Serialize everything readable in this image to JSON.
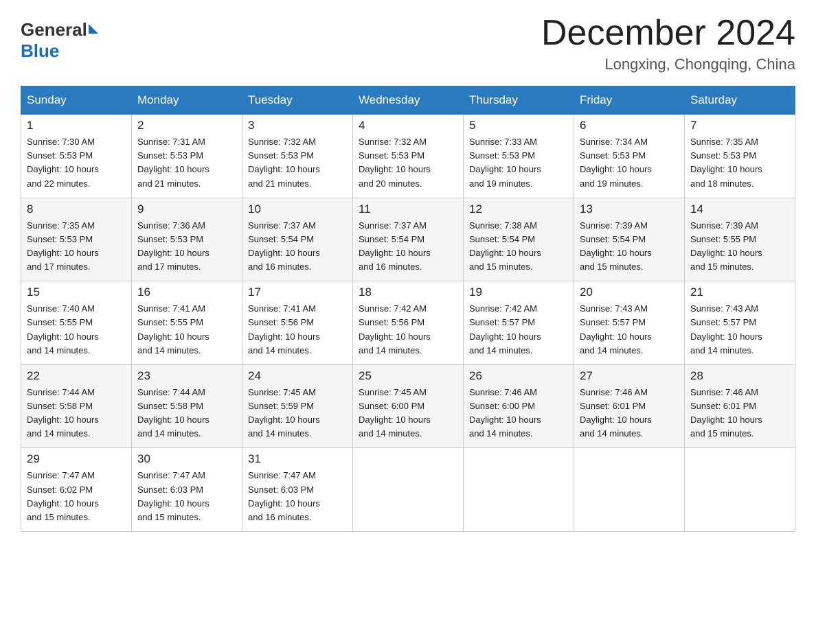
{
  "logo": {
    "general": "General",
    "blue": "Blue"
  },
  "header": {
    "month": "December 2024",
    "location": "Longxing, Chongqing, China"
  },
  "days_of_week": [
    "Sunday",
    "Monday",
    "Tuesday",
    "Wednesday",
    "Thursday",
    "Friday",
    "Saturday"
  ],
  "weeks": [
    [
      {
        "day": "1",
        "sunrise": "7:30 AM",
        "sunset": "5:53 PM",
        "daylight": "10 hours and 22 minutes."
      },
      {
        "day": "2",
        "sunrise": "7:31 AM",
        "sunset": "5:53 PM",
        "daylight": "10 hours and 21 minutes."
      },
      {
        "day": "3",
        "sunrise": "7:32 AM",
        "sunset": "5:53 PM",
        "daylight": "10 hours and 21 minutes."
      },
      {
        "day": "4",
        "sunrise": "7:32 AM",
        "sunset": "5:53 PM",
        "daylight": "10 hours and 20 minutes."
      },
      {
        "day": "5",
        "sunrise": "7:33 AM",
        "sunset": "5:53 PM",
        "daylight": "10 hours and 19 minutes."
      },
      {
        "day": "6",
        "sunrise": "7:34 AM",
        "sunset": "5:53 PM",
        "daylight": "10 hours and 19 minutes."
      },
      {
        "day": "7",
        "sunrise": "7:35 AM",
        "sunset": "5:53 PM",
        "daylight": "10 hours and 18 minutes."
      }
    ],
    [
      {
        "day": "8",
        "sunrise": "7:35 AM",
        "sunset": "5:53 PM",
        "daylight": "10 hours and 17 minutes."
      },
      {
        "day": "9",
        "sunrise": "7:36 AM",
        "sunset": "5:53 PM",
        "daylight": "10 hours and 17 minutes."
      },
      {
        "day": "10",
        "sunrise": "7:37 AM",
        "sunset": "5:54 PM",
        "daylight": "10 hours and 16 minutes."
      },
      {
        "day": "11",
        "sunrise": "7:37 AM",
        "sunset": "5:54 PM",
        "daylight": "10 hours and 16 minutes."
      },
      {
        "day": "12",
        "sunrise": "7:38 AM",
        "sunset": "5:54 PM",
        "daylight": "10 hours and 15 minutes."
      },
      {
        "day": "13",
        "sunrise": "7:39 AM",
        "sunset": "5:54 PM",
        "daylight": "10 hours and 15 minutes."
      },
      {
        "day": "14",
        "sunrise": "7:39 AM",
        "sunset": "5:55 PM",
        "daylight": "10 hours and 15 minutes."
      }
    ],
    [
      {
        "day": "15",
        "sunrise": "7:40 AM",
        "sunset": "5:55 PM",
        "daylight": "10 hours and 14 minutes."
      },
      {
        "day": "16",
        "sunrise": "7:41 AM",
        "sunset": "5:55 PM",
        "daylight": "10 hours and 14 minutes."
      },
      {
        "day": "17",
        "sunrise": "7:41 AM",
        "sunset": "5:56 PM",
        "daylight": "10 hours and 14 minutes."
      },
      {
        "day": "18",
        "sunrise": "7:42 AM",
        "sunset": "5:56 PM",
        "daylight": "10 hours and 14 minutes."
      },
      {
        "day": "19",
        "sunrise": "7:42 AM",
        "sunset": "5:57 PM",
        "daylight": "10 hours and 14 minutes."
      },
      {
        "day": "20",
        "sunrise": "7:43 AM",
        "sunset": "5:57 PM",
        "daylight": "10 hours and 14 minutes."
      },
      {
        "day": "21",
        "sunrise": "7:43 AM",
        "sunset": "5:57 PM",
        "daylight": "10 hours and 14 minutes."
      }
    ],
    [
      {
        "day": "22",
        "sunrise": "7:44 AM",
        "sunset": "5:58 PM",
        "daylight": "10 hours and 14 minutes."
      },
      {
        "day": "23",
        "sunrise": "7:44 AM",
        "sunset": "5:58 PM",
        "daylight": "10 hours and 14 minutes."
      },
      {
        "day": "24",
        "sunrise": "7:45 AM",
        "sunset": "5:59 PM",
        "daylight": "10 hours and 14 minutes."
      },
      {
        "day": "25",
        "sunrise": "7:45 AM",
        "sunset": "6:00 PM",
        "daylight": "10 hours and 14 minutes."
      },
      {
        "day": "26",
        "sunrise": "7:46 AM",
        "sunset": "6:00 PM",
        "daylight": "10 hours and 14 minutes."
      },
      {
        "day": "27",
        "sunrise": "7:46 AM",
        "sunset": "6:01 PM",
        "daylight": "10 hours and 14 minutes."
      },
      {
        "day": "28",
        "sunrise": "7:46 AM",
        "sunset": "6:01 PM",
        "daylight": "10 hours and 15 minutes."
      }
    ],
    [
      {
        "day": "29",
        "sunrise": "7:47 AM",
        "sunset": "6:02 PM",
        "daylight": "10 hours and 15 minutes."
      },
      {
        "day": "30",
        "sunrise": "7:47 AM",
        "sunset": "6:03 PM",
        "daylight": "10 hours and 15 minutes."
      },
      {
        "day": "31",
        "sunrise": "7:47 AM",
        "sunset": "6:03 PM",
        "daylight": "10 hours and 16 minutes."
      },
      null,
      null,
      null,
      null
    ]
  ],
  "labels": {
    "sunrise": "Sunrise:",
    "sunset": "Sunset:",
    "daylight": "Daylight:"
  }
}
